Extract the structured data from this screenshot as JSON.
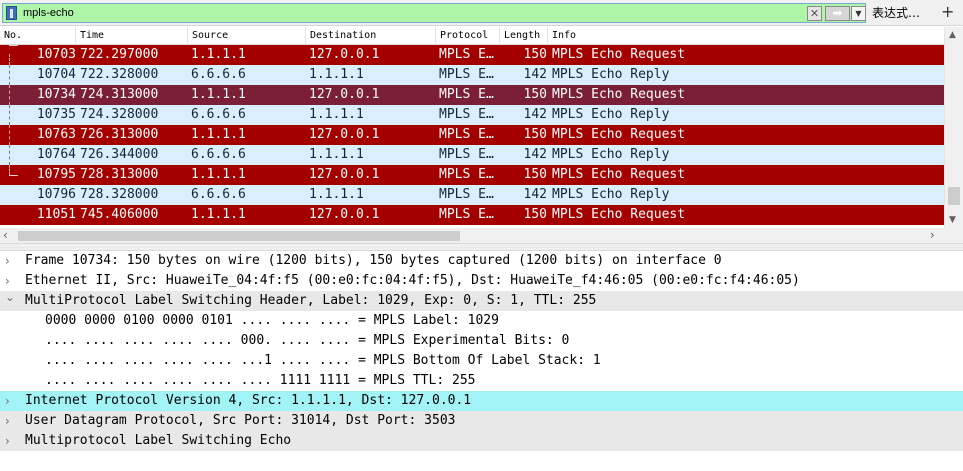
{
  "filter": {
    "value": "mpls-echo",
    "clear_icon": "x-icon",
    "apply_icon": "arrow-right-icon",
    "expression_label": "表达式…",
    "add_label": "+"
  },
  "columns": [
    "No.",
    "Time",
    "Source",
    "Destination",
    "Protocol",
    "Length",
    "Info"
  ],
  "colors": {
    "request_bg": "#a40000",
    "selected_bg": "#7b1f36",
    "reply_bg": "#daeeff",
    "highlight_bg": "#a2f3f6",
    "filter_bg": "#aff5a8"
  },
  "packets": [
    {
      "no": "10703",
      "time": "722.297000",
      "src": "1.1.1.1",
      "dst": "127.0.0.1",
      "proto": "MPLS E…",
      "len": "150",
      "info": "MPLS Echo Request",
      "type": "request"
    },
    {
      "no": "10704",
      "time": "722.328000",
      "src": "6.6.6.6",
      "dst": "1.1.1.1",
      "proto": "MPLS E…",
      "len": "142",
      "info": "MPLS Echo Reply",
      "type": "reply"
    },
    {
      "no": "10734",
      "time": "724.313000",
      "src": "1.1.1.1",
      "dst": "127.0.0.1",
      "proto": "MPLS E…",
      "len": "150",
      "info": "MPLS Echo Request",
      "type": "selected"
    },
    {
      "no": "10735",
      "time": "724.328000",
      "src": "6.6.6.6",
      "dst": "1.1.1.1",
      "proto": "MPLS E…",
      "len": "142",
      "info": "MPLS Echo Reply",
      "type": "reply"
    },
    {
      "no": "10763",
      "time": "726.313000",
      "src": "1.1.1.1",
      "dst": "127.0.0.1",
      "proto": "MPLS E…",
      "len": "150",
      "info": "MPLS Echo Request",
      "type": "request"
    },
    {
      "no": "10764",
      "time": "726.344000",
      "src": "6.6.6.6",
      "dst": "1.1.1.1",
      "proto": "MPLS E…",
      "len": "142",
      "info": "MPLS Echo Reply",
      "type": "reply"
    },
    {
      "no": "10795",
      "time": "728.313000",
      "src": "1.1.1.1",
      "dst": "127.0.0.1",
      "proto": "MPLS E…",
      "len": "150",
      "info": "MPLS Echo Request",
      "type": "request"
    },
    {
      "no": "10796",
      "time": "728.328000",
      "src": "6.6.6.6",
      "dst": "1.1.1.1",
      "proto": "MPLS E…",
      "len": "142",
      "info": "MPLS Echo Reply",
      "type": "reply"
    },
    {
      "no": "11051",
      "time": "745.406000",
      "src": "1.1.1.1",
      "dst": "127.0.0.1",
      "proto": "MPLS E…",
      "len": "150",
      "info": "MPLS Echo Request",
      "type": "request"
    }
  ],
  "details": [
    {
      "text": "Frame 10734: 150 bytes on wire (1200 bits), 150 bytes captured (1200 bits) on interface 0",
      "expand": "collapsed",
      "level": 0,
      "style": "normal"
    },
    {
      "text": "Ethernet II, Src: HuaweiTe_04:4f:f5 (00:e0:fc:04:4f:f5), Dst: HuaweiTe_f4:46:05 (00:e0:fc:f4:46:05)",
      "expand": "collapsed",
      "level": 0,
      "style": "normal"
    },
    {
      "text": "MultiProtocol Label Switching Header, Label: 1029, Exp: 0, S: 1, TTL: 255",
      "expand": "expanded",
      "level": 0,
      "style": "gray"
    },
    {
      "text": "0000 0000 0100 0000 0101 .... .... .... = MPLS Label: 1029",
      "expand": "none",
      "level": 1,
      "style": "normal"
    },
    {
      "text": ".... .... .... .... .... 000. .... .... = MPLS Experimental Bits: 0",
      "expand": "none",
      "level": 1,
      "style": "normal"
    },
    {
      "text": ".... .... .... .... .... ...1 .... .... = MPLS Bottom Of Label Stack: 1",
      "expand": "none",
      "level": 1,
      "style": "normal"
    },
    {
      "text": ".... .... .... .... .... .... 1111 1111 = MPLS TTL: 255",
      "expand": "none",
      "level": 1,
      "style": "normal"
    },
    {
      "text": "Internet Protocol Version 4, Src: 1.1.1.1, Dst: 127.0.0.1",
      "expand": "collapsed",
      "level": 0,
      "style": "highlight"
    },
    {
      "text": "User Datagram Protocol, Src Port: 31014, Dst Port: 3503",
      "expand": "collapsed",
      "level": 0,
      "style": "gray"
    },
    {
      "text": "Multiprotocol Label Switching Echo",
      "expand": "collapsed",
      "level": 0,
      "style": "gray"
    }
  ]
}
